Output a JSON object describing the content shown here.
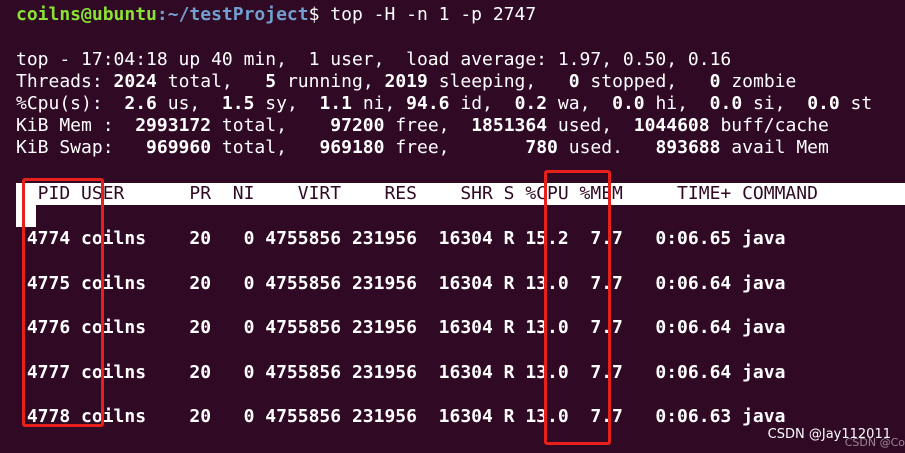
{
  "prompt": {
    "user_host": "coilns@ubuntu",
    "path": ":~/testProject",
    "symbol": "$",
    "command": " top -H -n 1 -p 2747"
  },
  "summary": {
    "line1": "top - 17:04:18 up 40 min,  1 user,  load average: 1.97, 0.50, 0.16",
    "threads_label": "Threads: ",
    "threads_total": "2024",
    "threads_total_label": " total,   ",
    "threads_running": "5",
    "threads_running_label": " running, ",
    "threads_sleeping": "2019",
    "threads_sleeping_label": " sleeping,   ",
    "threads_stopped": "0",
    "threads_stopped_label": " stopped,   ",
    "threads_zombie": "0",
    "threads_zombie_label": " zombie",
    "cpu_label": "%Cpu(s):  ",
    "cpu_us": "2.6",
    "cpu_us_label": " us,  ",
    "cpu_sy": "1.5",
    "cpu_sy_label": " sy,  ",
    "cpu_ni": "1.1",
    "cpu_ni_label": " ni, ",
    "cpu_id": "94.6",
    "cpu_id_label": " id,  ",
    "cpu_wa": "0.2",
    "cpu_wa_label": " wa,  ",
    "cpu_hi": "0.0",
    "cpu_hi_label": " hi,  ",
    "cpu_si": "0.0",
    "cpu_si_label": " si,  ",
    "cpu_st": "0.0",
    "cpu_st_label": " st",
    "mem_label": "KiB Mem :  ",
    "mem_total": "2993172",
    "mem_total_label": " total,    ",
    "mem_free": "97200",
    "mem_free_label": " free,  ",
    "mem_used": "1851364",
    "mem_used_label": " used,  ",
    "mem_buff": "1044608",
    "mem_buff_label": " buff/cache",
    "swap_label": "KiB Swap:   ",
    "swap_total": "969960",
    "swap_total_label": " total,   ",
    "swap_free": "969180",
    "swap_free_label": " free,       ",
    "swap_used": "780",
    "swap_used_label": " used.   ",
    "swap_avail": "893688",
    "swap_avail_label": " avail Mem"
  },
  "table": {
    "header": "  PID USER      PR  NI    VIRT    RES    SHR S %CPU %MEM     TIME+ COMMAND",
    "rows": [
      " 4774 coilns    20   0 4755856 231956  16304 R 15.2  7.7   0:06.65 java",
      " 4775 coilns    20   0 4755856 231956  16304 R 13.0  7.7   0:06.64 java",
      " 4776 coilns    20   0 4755856 231956  16304 R 13.0  7.7   0:06.64 java",
      " 4777 coilns    20   0 4755856 231956  16304 R 13.0  7.7   0:06.64 java",
      " 4778 coilns    20   0 4755856 231956  16304 R 13.0  7.7   0:06.63 java"
    ]
  },
  "watermark": {
    "main": "CSDN @Jay112011",
    "faint": "CSDN @Co"
  },
  "colors": {
    "background": "#300a24",
    "prompt_user": "#8ae234",
    "prompt_path": "#729fcf",
    "highlight": "#e8201b"
  }
}
